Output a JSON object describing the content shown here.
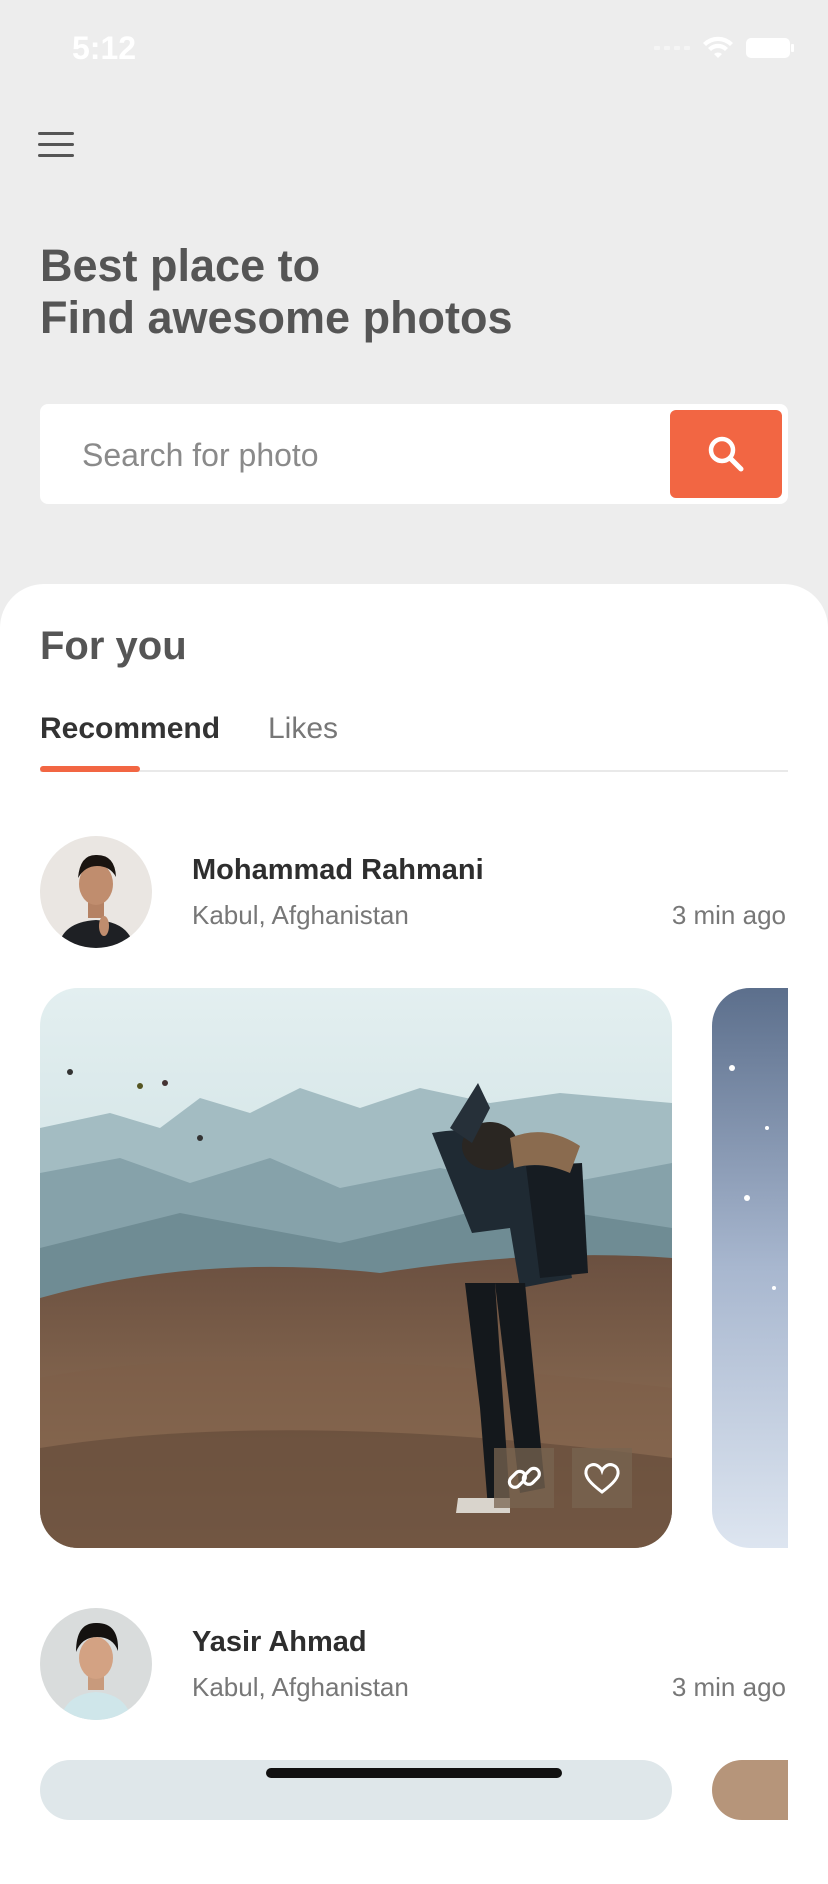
{
  "status_bar": {
    "time": "5:12"
  },
  "header": {
    "headline_line1": "Best place to",
    "headline_line2": "Find awesome photos"
  },
  "search": {
    "placeholder": "Search for photo",
    "value": ""
  },
  "feed": {
    "section_title": "For you",
    "tabs": [
      {
        "label": "Recommend",
        "active": true
      },
      {
        "label": "Likes",
        "active": false
      }
    ],
    "posts": [
      {
        "name": "Mohammad Rahmani",
        "location": "Kabul, Afghanistan",
        "time": "3 min ago"
      },
      {
        "name": "Yasir Ahmad",
        "location": "Kabul, Afghanistan",
        "time": "3 min ago"
      }
    ]
  },
  "colors": {
    "accent": "#f26643",
    "background": "#ededed",
    "heading": "#555555"
  },
  "icons": [
    "menu-icon",
    "search-icon",
    "link-icon",
    "heart-icon",
    "wifi-icon",
    "battery-icon"
  ]
}
